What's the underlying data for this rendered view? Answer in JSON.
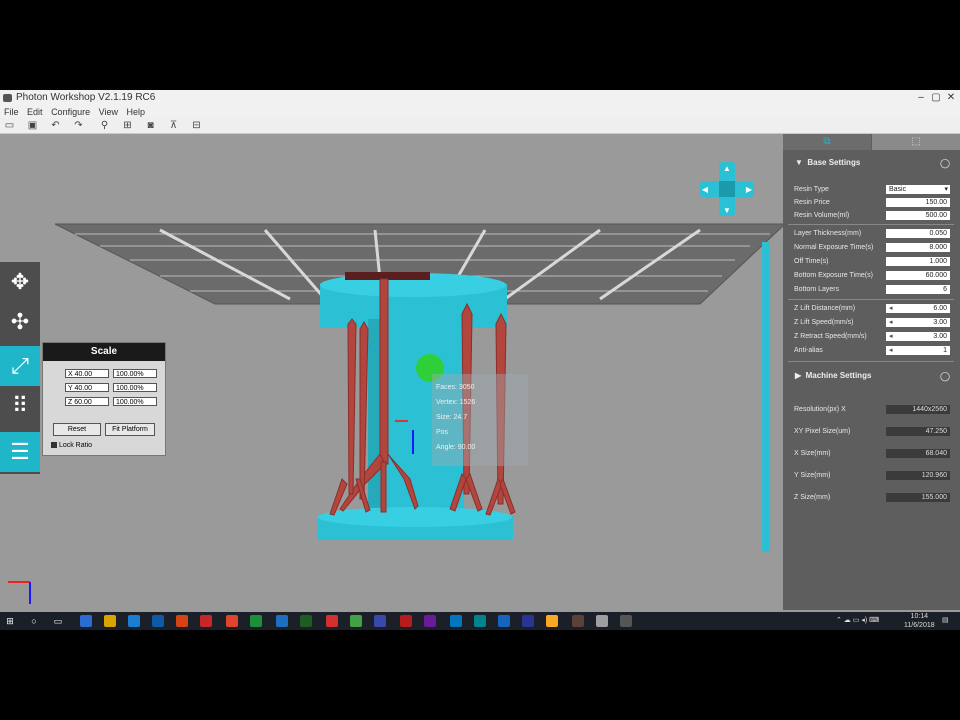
{
  "window": {
    "title": "Photon Workshop V2.1.19 RC6",
    "minimize": "–",
    "maximize": "▢",
    "close": "✕"
  },
  "menu": [
    "File",
    "Edit",
    "Configure",
    "View",
    "Help"
  ],
  "toolbar_icons": [
    "open-icon",
    "save-icon",
    "undo-icon",
    "redo-icon",
    "support-icon",
    "layout-icon",
    "hollow-icon",
    "punch-icon",
    "slice-icon"
  ],
  "left_tools": [
    "move-icon",
    "rotate-icon",
    "scale-icon",
    "layout-grid-icon",
    "layers-icon"
  ],
  "scale_panel": {
    "title": "Scale",
    "rows": [
      {
        "axis": "X",
        "size": "X 40.00",
        "percent": "100.00%"
      },
      {
        "axis": "Y",
        "size": "Y 40.00",
        "percent": "100.00%"
      },
      {
        "axis": "Z",
        "size": "Z 60.00",
        "percent": "100.00%"
      }
    ],
    "reset_label": "Reset",
    "fit_label": "Fit Platform",
    "lock_label": "Lock Ratio"
  },
  "model_info": {
    "faces": "Faces: 3050",
    "vertex": "Vertex: 1526",
    "size": "Size: 24.7",
    "pos": "Pos",
    "angle": "Angle: 90.00"
  },
  "right_panel": {
    "tabs": [
      "slice-settings-icon",
      "machine-icon"
    ],
    "base_section": "Base Settings",
    "base_rows": [
      {
        "label": "Resin Type",
        "value": "Basic",
        "kind": "select"
      },
      {
        "label": "Resin Price",
        "value": "150.00",
        "kind": "spin"
      },
      {
        "label": "Resin Volume(ml)",
        "value": "500.00",
        "kind": "text"
      },
      {
        "label": "Layer Thickness(mm)",
        "value": "0.050",
        "kind": "text"
      },
      {
        "label": "Normal Exposure Time(s)",
        "value": "8.000",
        "kind": "text"
      },
      {
        "label": "Off Time(s)",
        "value": "1.000",
        "kind": "text"
      },
      {
        "label": "Bottom Exposure Time(s)",
        "value": "60.000",
        "kind": "text"
      },
      {
        "label": "Bottom Layers",
        "value": "6",
        "kind": "text"
      },
      {
        "label": "Z Lift Distance(mm)",
        "value": "6.00",
        "kind": "spin"
      },
      {
        "label": "Z Lift Speed(mm/s)",
        "value": "3.00",
        "kind": "spin"
      },
      {
        "label": "Z Retract Speed(mm/s)",
        "value": "3.00",
        "kind": "spin"
      },
      {
        "label": "Anti-alias",
        "value": "1",
        "kind": "spin"
      }
    ],
    "machine_section": "Machine Settings",
    "machine_rows": [
      {
        "label": "Resolution(px) X",
        "value": "1440x2560"
      },
      {
        "label": "XY Pixel Size(um)",
        "value": "47.250"
      },
      {
        "label": "X Size(mm)",
        "value": "68.040"
      },
      {
        "label": "Y Size(mm)",
        "value": "120.960"
      },
      {
        "label": "Z Size(mm)",
        "value": "155.000"
      }
    ]
  },
  "taskbar": {
    "time": "10:14",
    "date": "11/6/2018"
  },
  "colors": {
    "accent": "#1fb6c9",
    "model": "#2bc0d4",
    "supports": "#b2453e",
    "panel": "#5e5e5e"
  }
}
